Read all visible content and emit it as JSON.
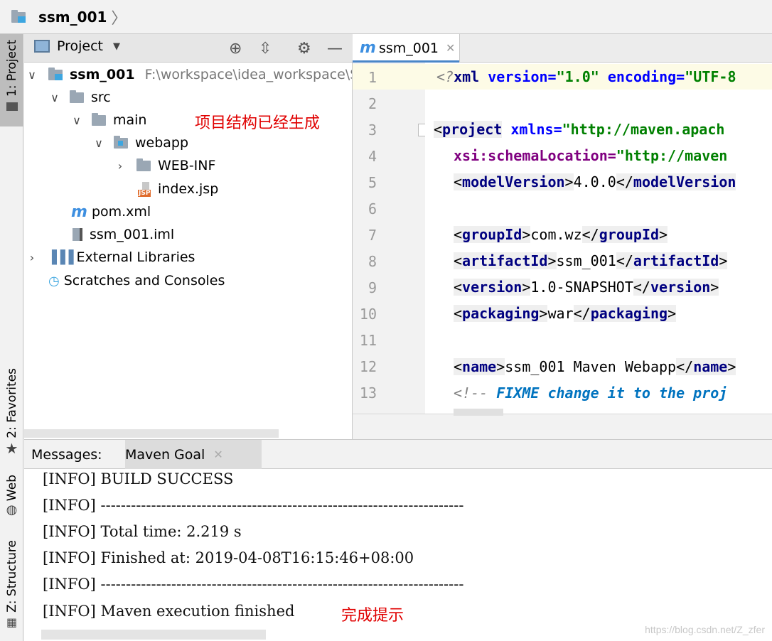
{
  "breadcrumb": {
    "project_name": "ssm_001"
  },
  "left_strip": {
    "project_tab": "1: Project",
    "favorites_tab": "2: Favorites",
    "web_tab": "Web",
    "structure_tab": "Z: Structure"
  },
  "project_panel": {
    "view_selector": "Project",
    "tree": [
      {
        "label": "ssm_001",
        "path": "F:\\workspace\\idea_workspace\\S"
      },
      {
        "label": "src"
      },
      {
        "label": "main"
      },
      {
        "label": "webapp"
      },
      {
        "label": "WEB-INF"
      },
      {
        "label": "index.jsp"
      },
      {
        "label": "pom.xml"
      },
      {
        "label": "ssm_001.iml"
      },
      {
        "label": "External Libraries"
      },
      {
        "label": "Scratches and Consoles"
      }
    ],
    "annotation": "项目结构已经生成"
  },
  "editor": {
    "tab_label": "ssm_001",
    "line_numbers": [
      "1",
      "2",
      "3",
      "4",
      "5",
      "6",
      "7",
      "8",
      "9",
      "10",
      "11",
      "12",
      "13"
    ],
    "lines": {
      "l1": {
        "open": "<?",
        "tag": "xml",
        "a1": " version=",
        "v1": "\"1.0\"",
        "a2": " encoding=",
        "v2": "\"UTF-8"
      },
      "l3": {
        "lt": "<",
        "tag": "project",
        "a1": " xmlns=",
        "v1": "\"http://maven.apach"
      },
      "l4": {
        "a1": "xsi:schemaLocation=",
        "v1": "\"http://maven"
      },
      "l5": {
        "lt1": "<",
        "tag": "modelVersion",
        "gt1": ">",
        "text": "4.0.0",
        "lt2": "</",
        "tag2": "modelVersion"
      },
      "l7": {
        "lt1": "<",
        "tag": "groupId",
        "gt1": ">",
        "text": "com.wz",
        "lt2": "</",
        "tag2": "groupId",
        "gt2": ">"
      },
      "l8": {
        "lt1": "<",
        "tag": "artifactId",
        "gt1": ">",
        "text": "ssm_001",
        "lt2": "</",
        "tag2": "artifactId",
        "gt2": ">"
      },
      "l9": {
        "lt1": "<",
        "tag": "version",
        "gt1": ">",
        "text": "1.0-SNAPSHOT",
        "lt2": "</",
        "tag2": "version",
        "gt2": ">"
      },
      "l10": {
        "lt1": "<",
        "tag": "packaging",
        "gt1": ">",
        "text": "war",
        "lt2": "</",
        "tag2": "packaging",
        "gt2": ">"
      },
      "l12": {
        "lt1": "<",
        "tag": "name",
        "gt1": ">",
        "text": "ssm_001 Maven Webapp",
        "lt2": "</",
        "tag2": "name",
        "gt2": ">"
      },
      "l13": {
        "open": "<!-- ",
        "todo": "FIXME change it to the proj"
      }
    }
  },
  "messages": {
    "label": "Messages:",
    "tab": "Maven Goal",
    "lines": [
      "[INFO] BUILD SUCCESS",
      "[INFO] ------------------------------------------------------------------------",
      "[INFO] Total time: 2.219 s",
      "[INFO] Finished at: 2019-04-08T16:15:46+08:00",
      "[INFO] ------------------------------------------------------------------------",
      "[INFO] Maven execution finished"
    ],
    "annotation": "完成提示",
    "watermark": "https://blog.csdn.net/Z_zfer"
  },
  "colors": {
    "tag": "#000080",
    "attr": "#0000ff",
    "string": "#008000",
    "comment": "#808080",
    "annotation": "#e00000",
    "accent": "#4a86c8"
  }
}
